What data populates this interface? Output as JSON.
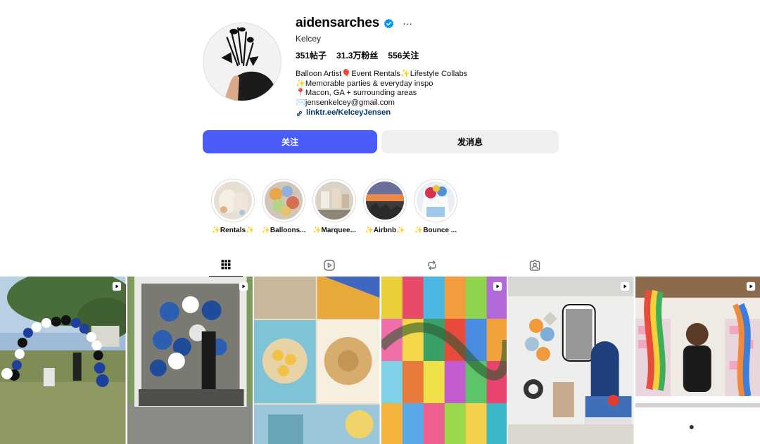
{
  "profile": {
    "username": "aidensarches",
    "more_label": "···",
    "full_name": "Kelcey",
    "stats": {
      "posts": "351帖子",
      "followers": "31.3万粉丝",
      "following": "556关注"
    },
    "bio": [
      "Balloon Artist🎈Event Rentals✨Lifestyle Collabs",
      "✨Memorable parties & everyday inspo",
      "📍Macon, GA + surrounding areas",
      "✉️jensenkelcey@gmail.com"
    ],
    "link": "linktr.ee/KelceyJensen"
  },
  "buttons": {
    "follow": "关注",
    "message": "发消息"
  },
  "highlights": [
    {
      "label": "✨Rentals✨"
    },
    {
      "label": "✨Balloons..."
    },
    {
      "label": "✨Marquee..."
    },
    {
      "label": "✨Airbnb✨"
    },
    {
      "label": "✨Bounce ..."
    }
  ],
  "tabs": [
    {
      "name": "posts",
      "icon": "grid-icon",
      "active": true
    },
    {
      "name": "reels",
      "icon": "reels-icon",
      "active": false
    },
    {
      "name": "reposts",
      "icon": "repost-icon",
      "active": false
    },
    {
      "name": "tagged",
      "icon": "tagged-icon",
      "active": false
    }
  ],
  "colors": {
    "accent": "#4a5df9",
    "verified": "#0095f6",
    "link": "#00376b"
  }
}
